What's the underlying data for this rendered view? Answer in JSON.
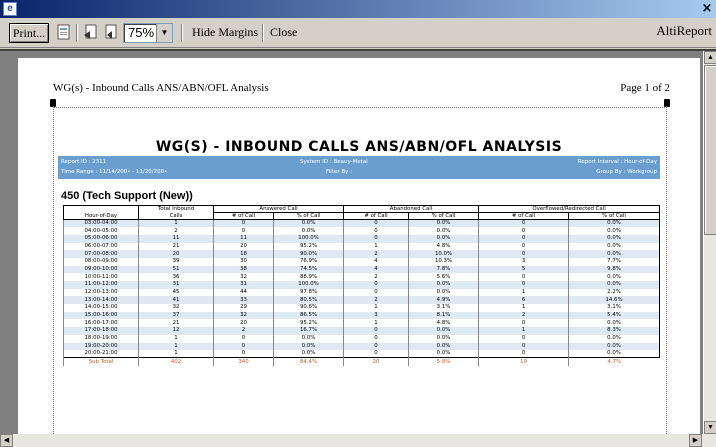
{
  "titlebar": {
    "close_glyph": "×"
  },
  "toolbar": {
    "print_label": "Print...",
    "zoom_value": "75%",
    "hide_margins_label": "Hide Margins",
    "close_label": "Close",
    "brand": "AltiReport"
  },
  "page": {
    "header_left": "WG(s) - Inbound Calls ANS/ABN/OFL Analysis",
    "header_right": "Page 1 of 2"
  },
  "report": {
    "title": "WG(S) - INBOUND CALLS ANS/ABN/OFL ANALYSIS",
    "report_id": "Report ID : 2311",
    "time_range": "Time Range : 11/14/200• - 11/20/200•",
    "system_id": "System ID : Beauy-Metal",
    "filter_by": "Filter By :",
    "report_interval": "Report Interval : Hour-of-Day",
    "group_by": "Group By : Workgroup",
    "group_title": "450 (Tech Support (New))"
  },
  "table": {
    "header_groups": [
      "",
      "Total Inbound",
      "Answered Call",
      "Abandoned Call",
      "Overflowed/Redirected Call"
    ],
    "columns": [
      "Hour-of-Day",
      "Calls",
      "# of Call",
      "% of Call",
      "# of Call",
      "% of Call",
      "# of Call",
      "% of Call"
    ],
    "rows": [
      [
        "03:00-04:00",
        "1",
        "0",
        "0.0%",
        "0",
        "0.0%",
        "0",
        "0.0%"
      ],
      [
        "04:00-05:00",
        "2",
        "0",
        "0.0%",
        "0",
        "0.0%",
        "0",
        "0.0%"
      ],
      [
        "05:00-06:00",
        "11",
        "11",
        "100.0%",
        "0",
        "0.0%",
        "0",
        "0.0%"
      ],
      [
        "06:00-07:00",
        "21",
        "20",
        "95.2%",
        "1",
        "4.8%",
        "0",
        "0.0%"
      ],
      [
        "07:00-08:00",
        "20",
        "18",
        "90.0%",
        "2",
        "10.0%",
        "0",
        "0.0%"
      ],
      [
        "08:00-09:00",
        "39",
        "30",
        "76.9%",
        "4",
        "10.3%",
        "3",
        "7.7%"
      ],
      [
        "09:00-10:00",
        "51",
        "38",
        "74.5%",
        "4",
        "7.8%",
        "5",
        "9.8%"
      ],
      [
        "10:00-11:00",
        "36",
        "32",
        "88.9%",
        "2",
        "5.6%",
        "0",
        "0.0%"
      ],
      [
        "11:00-12:00",
        "31",
        "31",
        "100.0%",
        "0",
        "0.0%",
        "0",
        "0.0%"
      ],
      [
        "12:00-13:00",
        "45",
        "44",
        "97.8%",
        "0",
        "0.0%",
        "1",
        "2.2%"
      ],
      [
        "13:00-14:00",
        "41",
        "33",
        "80.5%",
        "2",
        "4.9%",
        "6",
        "14.6%"
      ],
      [
        "14:00-15:00",
        "32",
        "29",
        "90.6%",
        "1",
        "3.1%",
        "1",
        "3.1%"
      ],
      [
        "15:00-16:00",
        "37",
        "32",
        "86.5%",
        "3",
        "8.1%",
        "2",
        "5.4%"
      ],
      [
        "16:00-17:00",
        "21",
        "20",
        "95.2%",
        "1",
        "4.8%",
        "0",
        "0.0%"
      ],
      [
        "17:00-18:00",
        "12",
        "2",
        "16.7%",
        "0",
        "0.0%",
        "1",
        "8.3%"
      ],
      [
        "18:00-19:00",
        "1",
        "0",
        "0.0%",
        "0",
        "0.0%",
        "0",
        "0.0%"
      ],
      [
        "19:00-20:00",
        "1",
        "0",
        "0.0%",
        "0",
        "0.0%",
        "0",
        "0.0%"
      ],
      [
        "20:00-21:00",
        "1",
        "0",
        "0.0%",
        "0",
        "0.0%",
        "0",
        "0.0%"
      ]
    ],
    "subtotal": [
      "Sub Total",
      "402",
      "340",
      "84.4%",
      "20",
      "5.0%",
      "19",
      "4.7%"
    ]
  },
  "colors": {
    "infobar": "#6a9ecf",
    "stripe": "#dfe9f3",
    "subtotal_text": "#cc5a20"
  },
  "icons": [
    "page-setup-icon",
    "first-page-icon",
    "prev-page-icon"
  ]
}
